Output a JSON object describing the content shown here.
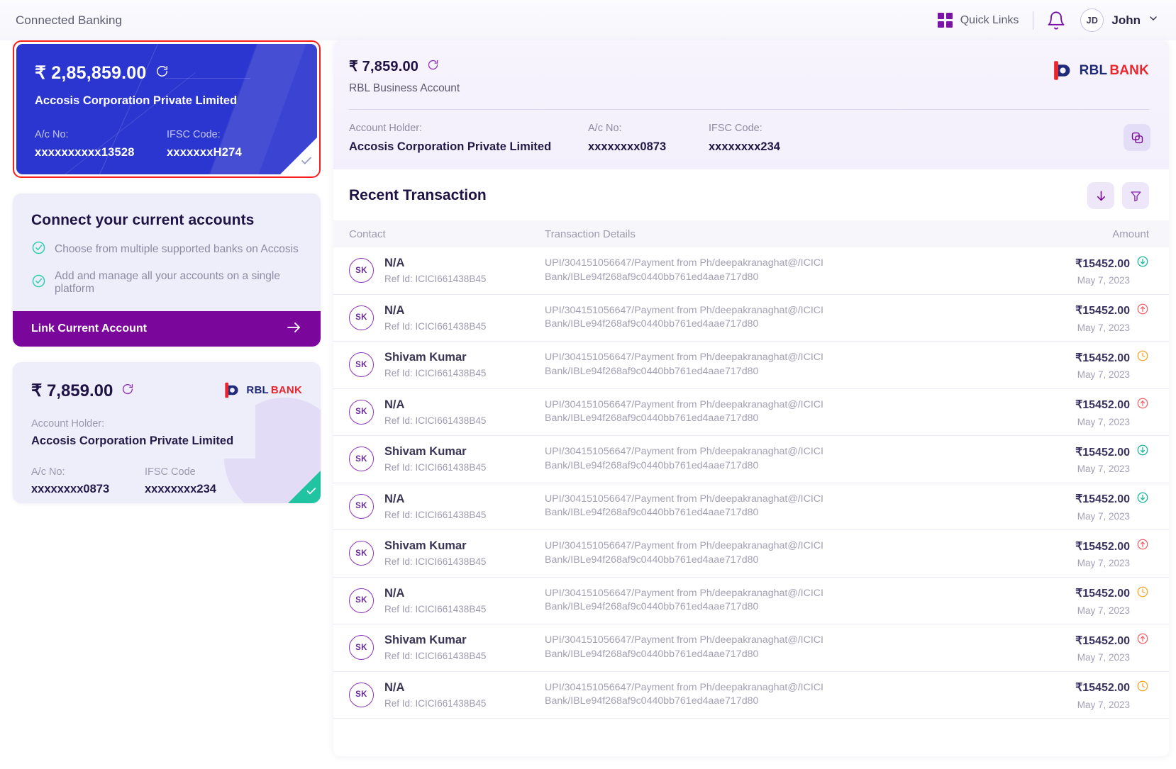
{
  "header": {
    "title": "Connected Banking",
    "quick_links_label": "Quick Links",
    "avatar_initials": "JD",
    "user_name": "John"
  },
  "sidebar": {
    "primary_card": {
      "balance": "₹ 2,85,859.00",
      "account_holder": "Accosis Corporation Private Limited",
      "acct_no_label": "A/c No:",
      "acct_no_value": "xxxxxxxxxx13528",
      "ifsc_label": "IFSC Code:",
      "ifsc_value": "xxxxxxxH274",
      "selected": true
    },
    "connect_card": {
      "title": "Connect your current accounts",
      "bullets": [
        "Choose from multiple supported banks on Accosis",
        "Add and manage all your accounts on a single platform"
      ],
      "cta_label": "Link Current Account"
    },
    "rbl_card": {
      "balance": "₹ 7,859.00",
      "bank_name_dark": "RBL",
      "bank_name_red": "BANK",
      "holder_label": "Account Holder:",
      "holder_value": "Accosis Corporation Private Limited",
      "acct_no_label": "A/c No:",
      "acct_no_value": "xxxxxxxx0873",
      "ifsc_label": "IFSC Code",
      "ifsc_value": "xxxxxxxx234"
    }
  },
  "main": {
    "account": {
      "balance": "₹ 7,859.00",
      "account_type": "RBL Business Account",
      "bank_name_dark": "RBL",
      "bank_name_red": "BANK",
      "holder_label": "Account Holder:",
      "holder_value": "Accosis Corporation Private Limited",
      "acct_no_label": "A/c No:",
      "acct_no_value": "xxxxxxxx0873",
      "ifsc_label": "IFSC Code:",
      "ifsc_value": "xxxxxxxx234"
    },
    "transactions": {
      "title": "Recent Transaction",
      "columns": {
        "contact": "Contact",
        "details": "Transaction Details",
        "amount": "Amount"
      },
      "rows": [
        {
          "initials": "SK",
          "name": "N/A",
          "ref": "Ref Id: ICICI661438B45",
          "details_line1": "UPI/304151056647/Payment from Ph/deepakranaghat@/ICICI",
          "details_line2": "Bank/IBLe94f268af9c0440bb761ed4aae717d80",
          "amount": "₹15452.00",
          "date": "May 7, 2023",
          "status": "credit"
        },
        {
          "initials": "SK",
          "name": "N/A",
          "ref": "Ref Id: ICICI661438B45",
          "details_line1": "UPI/304151056647/Payment from Ph/deepakranaghat@/ICICI",
          "details_line2": "Bank/IBLe94f268af9c0440bb761ed4aae717d80",
          "amount": "₹15452.00",
          "date": "May 7, 2023",
          "status": "debit"
        },
        {
          "initials": "SK",
          "name": "Shivam Kumar",
          "ref": "Ref Id: ICICI661438B45",
          "details_line1": "UPI/304151056647/Payment from Ph/deepakranaghat@/ICICI",
          "details_line2": "Bank/IBLe94f268af9c0440bb761ed4aae717d80",
          "amount": "₹15452.00",
          "date": "May 7, 2023",
          "status": "pending"
        },
        {
          "initials": "SK",
          "name": "N/A",
          "ref": "Ref Id: ICICI661438B45",
          "details_line1": "UPI/304151056647/Payment from Ph/deepakranaghat@/ICICI",
          "details_line2": "Bank/IBLe94f268af9c0440bb761ed4aae717d80",
          "amount": "₹15452.00",
          "date": "May 7, 2023",
          "status": "debit"
        },
        {
          "initials": "SK",
          "name": "Shivam Kumar",
          "ref": "Ref Id: ICICI661438B45",
          "details_line1": "UPI/304151056647/Payment from Ph/deepakranaghat@/ICICI",
          "details_line2": "Bank/IBLe94f268af9c0440bb761ed4aae717d80",
          "amount": "₹15452.00",
          "date": "May 7, 2023",
          "status": "credit"
        },
        {
          "initials": "SK",
          "name": "N/A",
          "ref": "Ref Id: ICICI661438B45",
          "details_line1": "UPI/304151056647/Payment from Ph/deepakranaghat@/ICICI",
          "details_line2": "Bank/IBLe94f268af9c0440bb761ed4aae717d80",
          "amount": "₹15452.00",
          "date": "May 7, 2023",
          "status": "credit"
        },
        {
          "initials": "SK",
          "name": "Shivam Kumar",
          "ref": "Ref Id: ICICI661438B45",
          "details_line1": "UPI/304151056647/Payment from Ph/deepakranaghat@/ICICI",
          "details_line2": "Bank/IBLe94f268af9c0440bb761ed4aae717d80",
          "amount": "₹15452.00",
          "date": "May 7, 2023",
          "status": "debit"
        },
        {
          "initials": "SK",
          "name": "N/A",
          "ref": "Ref Id: ICICI661438B45",
          "details_line1": "UPI/304151056647/Payment from Ph/deepakranaghat@/ICICI",
          "details_line2": "Bank/IBLe94f268af9c0440bb761ed4aae717d80",
          "amount": "₹15452.00",
          "date": "May 7, 2023",
          "status": "pending"
        },
        {
          "initials": "SK",
          "name": "Shivam Kumar",
          "ref": "Ref Id: ICICI661438B45",
          "details_line1": "UPI/304151056647/Payment from Ph/deepakranaghat@/ICICI",
          "details_line2": "Bank/IBLe94f268af9c0440bb761ed4aae717d80",
          "amount": "₹15452.00",
          "date": "May 7, 2023",
          "status": "debit"
        },
        {
          "initials": "SK",
          "name": "N/A",
          "ref": "Ref Id: ICICI661438B45",
          "details_line1": "UPI/304151056647/Payment from Ph/deepakranaghat@/ICICI",
          "details_line2": "Bank/IBLe94f268af9c0440bb761ed4aae717d80",
          "amount": "₹15452.00",
          "date": "May 7, 2023",
          "status": "pending"
        }
      ]
    }
  },
  "colors": {
    "card_blue": "#2b35cf",
    "selected_border": "#fc1c1c",
    "purple": "#7a069b",
    "accent_purple": "#7b13a8",
    "teal": "#20c4a0",
    "credit_green": "#16b79a",
    "debit_red": "#f4636a",
    "pending_orange": "#f5a623",
    "rbl_navy": "#1f2a7a",
    "rbl_red": "#e8262c"
  }
}
